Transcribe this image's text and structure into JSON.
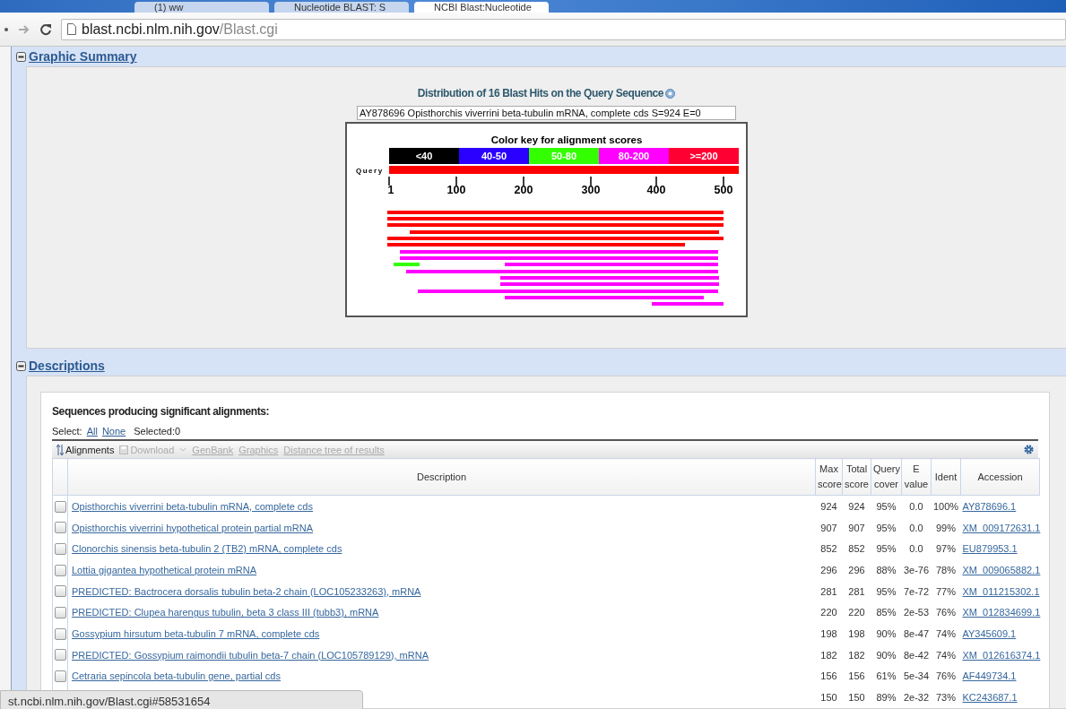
{
  "browser": {
    "tabs": [
      {
        "title": "(1) ww",
        "selected": false
      },
      {
        "title": "Nucleotide BLAST: S",
        "selected": false
      },
      {
        "title": "NCBI Blast:Nucleotide",
        "selected": true
      }
    ],
    "address": {
      "host": "blast.ncbi.nlm.nih.gov",
      "path": "/Blast.cgi"
    }
  },
  "graphic_summary": {
    "heading": "Graphic Summary",
    "expanded": true,
    "title": "Distribution of 16 Blast Hits on the Query Sequence",
    "hit_info": "AY878696 Opisthorchis viverrini beta-tubulin mRNA, complete cds S=924 E=0",
    "color_key": {
      "title": "Color key for alignment scores",
      "bins": [
        {
          "label": "<40",
          "color": "#000000"
        },
        {
          "label": "40-50",
          "color": "#2b00ff"
        },
        {
          "label": "50-80",
          "color": "#33ff00"
        },
        {
          "label": "80-200",
          "color": "#ff00ff"
        },
        {
          "label": ">=200",
          "color": "#ff0033"
        }
      ]
    },
    "query_label": "Query",
    "axis_ticks": [
      "1",
      "100",
      "200",
      "300",
      "400",
      "500"
    ],
    "hits": [
      {
        "color": "#ff0000"
      },
      {
        "color": "#ff0000"
      },
      {
        "color": "#ff0000"
      },
      {
        "color": "#ff0000"
      },
      {
        "color": "#ff0000"
      },
      {
        "color": "#ff0000"
      },
      {
        "color": "#ff00ff"
      },
      {
        "color": "#ff00ff"
      },
      {
        "color": "#33ff00"
      },
      {
        "color": "#ff00ff"
      },
      {
        "color": "#ff00ff"
      },
      {
        "color": "#ff00ff"
      },
      {
        "color": "#ff00ff"
      },
      {
        "color": "#ff00ff"
      },
      {
        "color": "#ff00ff"
      },
      {
        "color": "#ff00ff"
      }
    ]
  },
  "descriptions": {
    "heading": "Descriptions",
    "expanded": true,
    "subtitle": "Sequences producing significant alignments:",
    "select_label": "Select:",
    "select_all": "All",
    "select_none": "None",
    "selected_count": "Selected:0",
    "toolbar": [
      {
        "kind": "toggle",
        "label": "Alignments",
        "disabled": false
      },
      {
        "kind": "menu",
        "label": "Download",
        "disabled": true
      },
      {
        "kind": "link",
        "label": "GenBank",
        "disabled": true
      },
      {
        "kind": "link",
        "label": "Graphics",
        "disabled": true
      },
      {
        "kind": "link",
        "label": "Distance tree of results",
        "disabled": true
      }
    ],
    "columns": [
      "Description",
      "Max score",
      "Total score",
      "Query cover",
      "E value",
      "Ident",
      "Accession"
    ],
    "rows": [
      {
        "checked": false,
        "description": "Opisthorchis viverrini beta-tubulin mRNA, complete cds",
        "max": "924",
        "total": "924",
        "cover": "95%",
        "evalue": "0.0",
        "ident": "100%",
        "accession": "AY878696.1"
      },
      {
        "checked": false,
        "description": "Opisthorchis viverrini hypothetical protein partial mRNA",
        "max": "907",
        "total": "907",
        "cover": "95%",
        "evalue": "0.0",
        "ident": "99%",
        "accession": "XM_009172631.1"
      },
      {
        "checked": false,
        "description": "Clonorchis sinensis beta-tubulin 2 (TB2) mRNA, complete cds",
        "max": "852",
        "total": "852",
        "cover": "95%",
        "evalue": "0.0",
        "ident": "97%",
        "accession": "EU879953.1"
      },
      {
        "checked": false,
        "description": "Lottia gigantea hypothetical protein mRNA",
        "max": "296",
        "total": "296",
        "cover": "88%",
        "evalue": "3e-76",
        "ident": "78%",
        "accession": "XM_009065882.1"
      },
      {
        "checked": false,
        "description": "PREDICTED: Bactrocera dorsalis tubulin beta-2 chain (LOC105233263), mRNA",
        "max": "281",
        "total": "281",
        "cover": "95%",
        "evalue": "7e-72",
        "ident": "77%",
        "accession": "XM_011215302.1"
      },
      {
        "checked": false,
        "description": "PREDICTED: Clupea harengus tubulin, beta 3 class III (tubb3), mRNA",
        "max": "220",
        "total": "220",
        "cover": "85%",
        "evalue": "2e-53",
        "ident": "76%",
        "accession": "XM_012834699.1"
      },
      {
        "checked": false,
        "description": "Gossypium hirsutum beta-tubulin 7 mRNA, complete cds",
        "max": "198",
        "total": "198",
        "cover": "90%",
        "evalue": "8e-47",
        "ident": "74%",
        "accession": "AY345609.1"
      },
      {
        "checked": false,
        "description": "PREDICTED: Gossypium raimondii tubulin beta-7 chain (LOC105789129), mRNA",
        "max": "182",
        "total": "182",
        "cover": "90%",
        "evalue": "8e-42",
        "ident": "74%",
        "accession": "XM_012616374.1"
      },
      {
        "checked": false,
        "description": "Cetraria sepincola beta-tubulin gene, partial cds",
        "max": "156",
        "total": "156",
        "cover": "61%",
        "evalue": "5e-34",
        "ident": "76%",
        "accession": "AF449734.1"
      },
      {
        "max": "150",
        "total": "150",
        "cover": "89%",
        "evalue": "2e-32",
        "ident": "73%",
        "accession": "KC243687.1"
      }
    ]
  },
  "status_bubble": "st.ncbi.nlm.nih.gov/Blast.cgi#58531654"
}
